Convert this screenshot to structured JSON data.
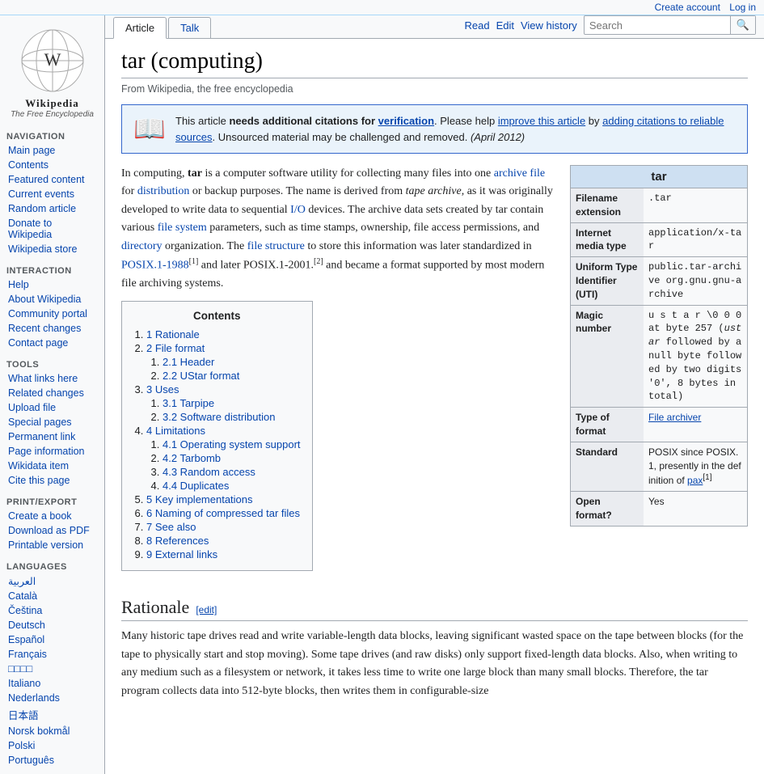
{
  "topbar": {
    "create_account": "Create account",
    "log_in": "Log in"
  },
  "logo": {
    "title": "Wikipedia",
    "subtitle": "The Free Encyclopedia"
  },
  "sidebar": {
    "navigation": {
      "title": "Navigation",
      "items": [
        {
          "label": "Main page",
          "href": "#"
        },
        {
          "label": "Contents",
          "href": "#"
        },
        {
          "label": "Featured content",
          "href": "#"
        },
        {
          "label": "Current events",
          "href": "#"
        },
        {
          "label": "Random article",
          "href": "#"
        },
        {
          "label": "Donate to Wikipedia",
          "href": "#"
        },
        {
          "label": "Wikipedia store",
          "href": "#"
        }
      ]
    },
    "interaction": {
      "title": "Interaction",
      "items": [
        {
          "label": "Help",
          "href": "#"
        },
        {
          "label": "About Wikipedia",
          "href": "#"
        },
        {
          "label": "Community portal",
          "href": "#"
        },
        {
          "label": "Recent changes",
          "href": "#"
        },
        {
          "label": "Contact page",
          "href": "#"
        }
      ]
    },
    "tools": {
      "title": "Tools",
      "items": [
        {
          "label": "What links here",
          "href": "#"
        },
        {
          "label": "Related changes",
          "href": "#"
        },
        {
          "label": "Upload file",
          "href": "#"
        },
        {
          "label": "Special pages",
          "href": "#"
        },
        {
          "label": "Permanent link",
          "href": "#"
        },
        {
          "label": "Page information",
          "href": "#"
        },
        {
          "label": "Wikidata item",
          "href": "#"
        },
        {
          "label": "Cite this page",
          "href": "#"
        }
      ]
    },
    "print_export": {
      "title": "Print/export",
      "items": [
        {
          "label": "Create a book",
          "href": "#"
        },
        {
          "label": "Download as PDF",
          "href": "#"
        },
        {
          "label": "Printable version",
          "href": "#"
        }
      ]
    },
    "languages": {
      "title": "Languages",
      "items": [
        {
          "label": "العربية"
        },
        {
          "label": "Català"
        },
        {
          "label": "Čeština"
        },
        {
          "label": "Deutsch"
        },
        {
          "label": "Español"
        },
        {
          "label": "Français"
        },
        {
          "label": "日本語"
        },
        {
          "label": "Italiano"
        },
        {
          "label": "Nederlands"
        },
        {
          "label": "日本語"
        },
        {
          "label": "Norsk bokmål"
        },
        {
          "label": "Polski"
        },
        {
          "label": "Português"
        }
      ]
    }
  },
  "tabs": {
    "left": [
      {
        "label": "Article",
        "active": true
      },
      {
        "label": "Talk"
      }
    ],
    "right": [
      {
        "label": "Read"
      },
      {
        "label": "Edit"
      },
      {
        "label": "View history"
      }
    ]
  },
  "search": {
    "placeholder": "Search",
    "button": "🔍"
  },
  "article": {
    "title": "tar (computing)",
    "subtitle": "From Wikipedia, the free encyclopedia",
    "notice": {
      "text_before": "This article ",
      "bold_text": "needs additional citations for",
      "link_text": "verification",
      "text_after": ". Please help ",
      "link2_text": "improve this article",
      "text2": " by ",
      "link3_text": "adding citations to reliable sources",
      "text3": ". Unsourced material may be challenged and removed.",
      "date": "(April 2012)"
    },
    "intro": "In computing, tar is a computer software utility for collecting many files into one archive file for distribution or backup purposes. The name is derived from tape archive, as it was originally developed to write data to sequential I/O devices. The archive data sets created by tar contain various file system parameters, such as time stamps, ownership, file access permissions, and directory organization. The file structure to store this information was later standardized in POSIX.1-1988[1] and later POSIX.1-2001.[2] and became a format supported by most modern file archiving systems.",
    "infobox": {
      "title": "tar",
      "rows": [
        {
          "label": "Filename extension",
          "value": ".tar"
        },
        {
          "label": "Internet media type",
          "value": "application/x-tar"
        },
        {
          "label": "Uniform Type Identifier (UTI)",
          "value": "public.tar-archive org.gnu.gnu-archive"
        },
        {
          "label": "Magic number",
          "value": "u s t a r \\0 0 0 at byte 257 (ustar followed by a null byte followed by two digits '0', 8 bytes in total)"
        },
        {
          "label": "Type of format",
          "value": "File archiver",
          "link": true
        },
        {
          "label": "Standard",
          "value": "POSIX since POSIX.1, presently in the definition of pax[1]"
        },
        {
          "label": "Open format?",
          "value": "Yes"
        }
      ]
    },
    "toc": {
      "title": "Contents",
      "items": [
        {
          "num": "1",
          "label": "Rationale",
          "sub": []
        },
        {
          "num": "2",
          "label": "File format",
          "sub": [
            {
              "num": "2.1",
              "label": "Header"
            },
            {
              "num": "2.2",
              "label": "UStar format"
            }
          ]
        },
        {
          "num": "3",
          "label": "Uses",
          "sub": [
            {
              "num": "3.1",
              "label": "Tarpipe"
            },
            {
              "num": "3.2",
              "label": "Software distribution"
            }
          ]
        },
        {
          "num": "4",
          "label": "Limitations",
          "sub": [
            {
              "num": "4.1",
              "label": "Operating system support"
            },
            {
              "num": "4.2",
              "label": "Tarbomb"
            },
            {
              "num": "4.3",
              "label": "Random access"
            },
            {
              "num": "4.4",
              "label": "Duplicates"
            }
          ]
        },
        {
          "num": "5",
          "label": "Key implementations",
          "sub": []
        },
        {
          "num": "6",
          "label": "Naming of compressed tar files",
          "sub": []
        },
        {
          "num": "7",
          "label": "See also",
          "sub": []
        },
        {
          "num": "8",
          "label": "References",
          "sub": []
        },
        {
          "num": "9",
          "label": "External links",
          "sub": []
        }
      ]
    },
    "rationale_title": "Rationale",
    "edit_label": "[edit]",
    "rationale_text": "Many historic tape drives read and write variable-length data blocks, leaving significant wasted space on the tape between blocks (for the tape to physically start and stop moving). Some tape drives (and raw disks) only support fixed-length data blocks. Also, when writing to any medium such as a filesystem or network, it takes less time to write one large block than many small blocks. Therefore, the tar program collects data into 512-byte blocks, then writes them in configurable-size"
  },
  "colors": {
    "link": "#0645ad",
    "visited_link": "#0b0080",
    "tab_active_bg": "#ffffff",
    "tab_bg": "#f8f9fa",
    "border": "#a2a9b1",
    "notice_bg": "#eaf3fb",
    "infobox_header": "#cee0f2",
    "sidebar_bg": "#f8f9fa"
  }
}
